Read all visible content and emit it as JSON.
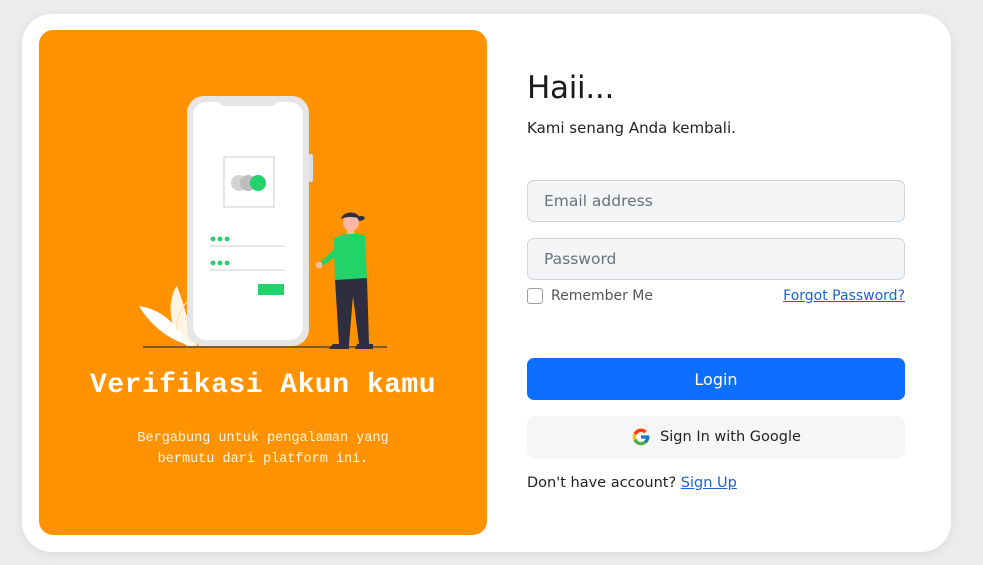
{
  "colors": {
    "page_bg": "#ececec",
    "panel_orange": "#ff9200",
    "primary_blue": "#0d6efd",
    "link_blue": "#1b62d6",
    "accent_green": "#22d36a"
  },
  "hero": {
    "title": "Verifikasi Akun kamu",
    "subtitle": "Bergabung untuk pengalaman yang bermutu dari platform ini.",
    "illustration_icon": "phone-login-illustration"
  },
  "login": {
    "greeting": "Haii...",
    "welcome": "Kami senang Anda kembali.",
    "email_placeholder": "Email address",
    "email_value": "",
    "password_placeholder": "Password",
    "password_value": "",
    "remember_label": "Remember Me",
    "remember_checked": false,
    "forgot_label": "Forgot Password?",
    "login_label": "Login",
    "google_label": "Sign In with Google",
    "google_icon": "google-icon",
    "no_account_text": "Don't have account?",
    "signup_label": "Sign Up"
  }
}
